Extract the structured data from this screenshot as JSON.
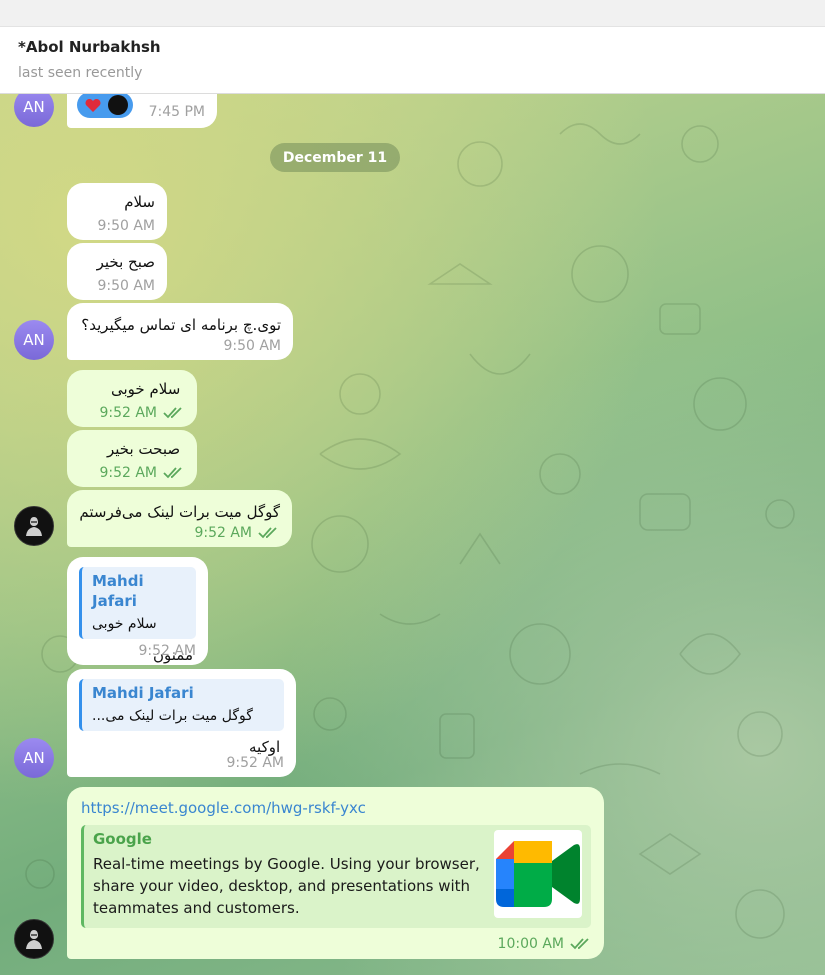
{
  "header": {
    "title": "*Abol Nurbakhsh",
    "status": "last seen recently"
  },
  "date_separator": "December 11",
  "avatars": {
    "an_initials": "AN"
  },
  "top_partial": {
    "time": "7:45 PM"
  },
  "messages": [
    {
      "text": "سلام",
      "time": "9:50 AM"
    },
    {
      "text": "صبح بخیر",
      "time": "9:50 AM"
    },
    {
      "text": "توی.چ برنامه ای تماس میگیرید؟",
      "time": "9:50 AM"
    },
    {
      "text": "سلام خوبی",
      "time": "9:52 AM"
    },
    {
      "text": "صبحت بخیر",
      "time": "9:52 AM"
    },
    {
      "text": "گوگل میت برات لینک می‌فرستم",
      "time": "9:52 AM"
    },
    {
      "reply_name": "Mahdi Jafari",
      "reply_text": "سلام خوبی",
      "text": "ممنون",
      "time": "9:52 AM"
    },
    {
      "reply_name": "Mahdi Jafari",
      "reply_text": "گوگل میت برات لینک می...",
      "text": "اوکیه",
      "time": "9:52 AM"
    }
  ],
  "link_message": {
    "url": "https://meet.google.com/hwg-rskf-yxc",
    "site": "Google",
    "description": "Real-time meetings by Google. Using your browser, share your video, desktop, and presentations with teammates and customers.",
    "time": "10:00 AM"
  },
  "colors": {
    "incoming": "#ffffff",
    "outgoing": "#eefed9",
    "accent": "#3a86d0",
    "check": "#5ba85c"
  },
  "icons": [
    "heart-reaction-icon",
    "reactor-avatar-icon",
    "double-check-icon",
    "google-meet-icon",
    "hacker-avatar-icon"
  ]
}
